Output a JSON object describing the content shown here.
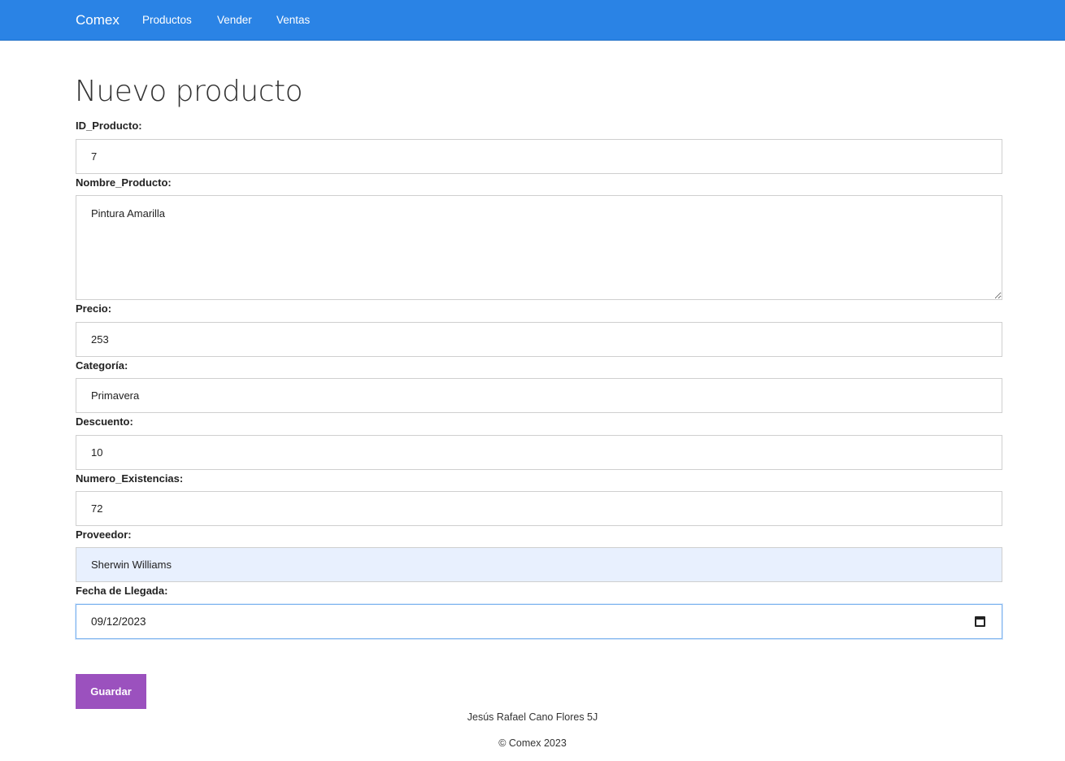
{
  "nav": {
    "brand": "Comex",
    "links": [
      "Productos",
      "Vender",
      "Ventas"
    ]
  },
  "page": {
    "title": "Nuevo producto"
  },
  "form": {
    "id_label": "ID_Producto:",
    "id_value": "7",
    "name_label": "Nombre_Producto:",
    "name_value": "Pintura Amarilla",
    "price_label": "Precio:",
    "price_value": "253",
    "category_label": "Categoría:",
    "category_value": "Primavera",
    "discount_label": "Descuento:",
    "discount_value": "10",
    "stock_label": "Numero_Existencias:",
    "stock_value": "72",
    "supplier_label": "Proveedor:",
    "supplier_value": "Sherwin Williams",
    "date_label": "Fecha de Llegada:",
    "date_value": "09/12/2023",
    "save_label": "Guardar"
  },
  "footer": {
    "author": "Jesús Rafael Cano Flores 5J",
    "copyright": "© Comex 2023"
  },
  "colors": {
    "navbar": "#2a83e5",
    "save_button": "#9b51be",
    "autofill_bg": "#e8f0fe"
  }
}
